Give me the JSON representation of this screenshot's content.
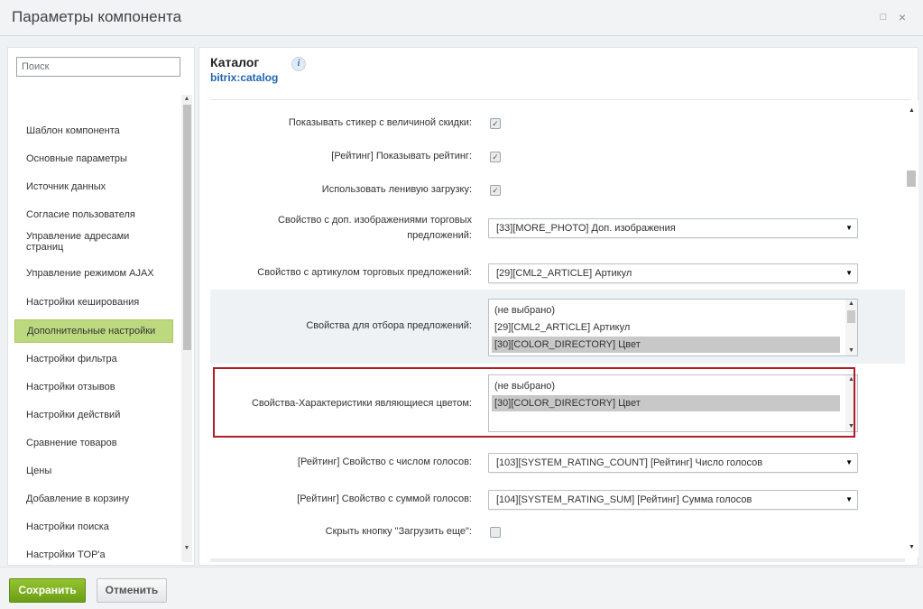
{
  "window": {
    "title": "Параметры компонента",
    "restore_icon": "□",
    "close_icon": "×"
  },
  "sidebar": {
    "search_placeholder": "Поиск",
    "items": [
      {
        "label": "Шаблон компонента"
      },
      {
        "label": "Основные параметры"
      },
      {
        "label": "Источник данных"
      },
      {
        "label": "Согласие пользователя"
      },
      {
        "label": "Управление адресами страниц"
      },
      {
        "label": "Управление режимом AJAX"
      },
      {
        "label": "Настройки кеширования"
      },
      {
        "label": "Дополнительные настройки",
        "active": true
      },
      {
        "label": "Настройки фильтра"
      },
      {
        "label": "Настройки отзывов"
      },
      {
        "label": "Настройки действий"
      },
      {
        "label": "Сравнение товаров"
      },
      {
        "label": "Цены"
      },
      {
        "label": "Добавление в корзину"
      },
      {
        "label": "Настройки поиска"
      },
      {
        "label": "Настройки TOP'a"
      }
    ]
  },
  "component": {
    "name": "Каталог",
    "code": "bitrix:catalog",
    "info_icon": "i"
  },
  "properties": [
    {
      "label": "Показывать стикер с величиной скидки:",
      "type": "checkbox",
      "checked": true
    },
    {
      "label": "[Рейтинг] Показывать рейтинг:",
      "type": "checkbox",
      "checked": true
    },
    {
      "label": "Использовать ленивую загрузку:",
      "type": "checkbox",
      "checked": true
    },
    {
      "label_line1": "Свойство с доп. изображениями торговых",
      "label_line2": "предложений:",
      "type": "select",
      "value": "[33][MORE_PHOTO] Доп. изображения"
    },
    {
      "label": "Свойство с артикулом торговых предложений:",
      "type": "select",
      "value": "[29][CML2_ARTICLE] Артикул"
    },
    {
      "label": "Свойства для отбора предложений:",
      "type": "multiselect",
      "options": [
        "(не выбрано)",
        "[29][CML2_ARTICLE] Артикул",
        "[30][COLOR_DIRECTORY] Цвет"
      ],
      "selected": "[30][COLOR_DIRECTORY] Цвет"
    },
    {
      "label": "Свойства-Характеристики являющиеся цветом:",
      "type": "multiselect",
      "options": [
        "(не выбрано)",
        "[30][COLOR_DIRECTORY] Цвет"
      ],
      "selected": "[30][COLOR_DIRECTORY] Цвет"
    },
    {
      "label": "[Рейтинг] Свойство с числом голосов:",
      "type": "select",
      "value": "[103][SYSTEM_RATING_COUNT] [Рейтинг] Число голосов"
    },
    {
      "label": "[Рейтинг] Свойство с суммой голосов:",
      "type": "select",
      "value": "[104][SYSTEM_RATING_SUM] [Рейтинг] Сумма голосов"
    },
    {
      "label": "Скрыть кнопку \"Загрузить еще\":",
      "type": "checkbox",
      "checked": false
    }
  ],
  "footer": {
    "save_label": "Сохранить",
    "cancel_label": "Отменить"
  },
  "colors": {
    "save_button": "#7aad1e",
    "active_nav": "#bcd980",
    "highlight_border": "#b21c25",
    "link_blue": "#2066b0"
  }
}
